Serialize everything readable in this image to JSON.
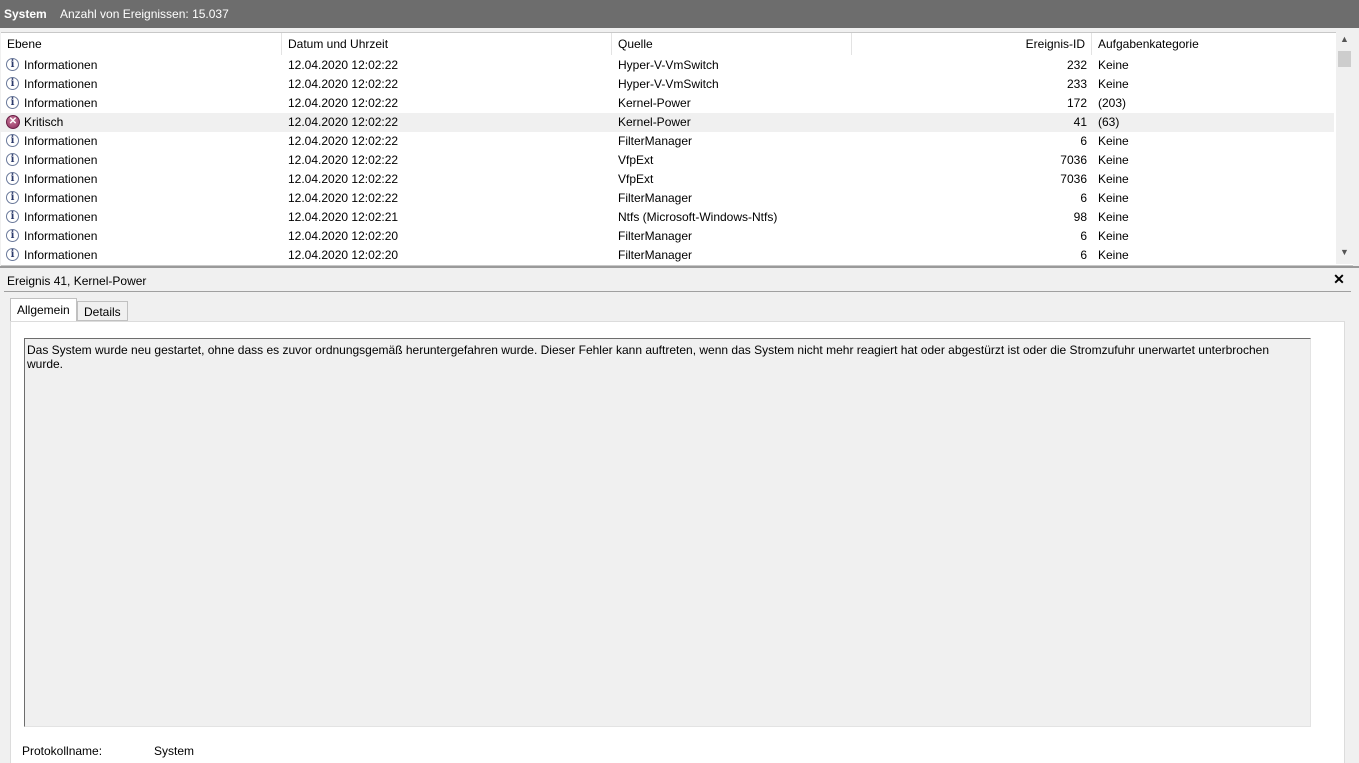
{
  "header": {
    "log_name": "System",
    "event_count_text": "Anzahl von Ereignissen: 15.037"
  },
  "table": {
    "columns": [
      "Ebene",
      "Datum und Uhrzeit",
      "Quelle",
      "Ereignis-ID",
      "Aufgabenkategorie"
    ],
    "rows": [
      {
        "level": "Informationen",
        "level_icon": "info-icon",
        "datetime": "12.04.2020 12:02:22",
        "source": "Hyper-V-VmSwitch",
        "id": "232",
        "category": "Keine"
      },
      {
        "level": "Informationen",
        "level_icon": "info-icon",
        "datetime": "12.04.2020 12:02:22",
        "source": "Hyper-V-VmSwitch",
        "id": "233",
        "category": "Keine"
      },
      {
        "level": "Informationen",
        "level_icon": "info-icon",
        "datetime": "12.04.2020 12:02:22",
        "source": "Kernel-Power",
        "id": "172",
        "category": "(203)"
      },
      {
        "level": "Kritisch",
        "level_icon": "critical-icon",
        "datetime": "12.04.2020 12:02:22",
        "source": "Kernel-Power",
        "id": "41",
        "category": "(63)",
        "selected": true
      },
      {
        "level": "Informationen",
        "level_icon": "info-icon",
        "datetime": "12.04.2020 12:02:22",
        "source": "FilterManager",
        "id": "6",
        "category": "Keine"
      },
      {
        "level": "Informationen",
        "level_icon": "info-icon",
        "datetime": "12.04.2020 12:02:22",
        "source": "VfpExt",
        "id": "7036",
        "category": "Keine"
      },
      {
        "level": "Informationen",
        "level_icon": "info-icon",
        "datetime": "12.04.2020 12:02:22",
        "source": "VfpExt",
        "id": "7036",
        "category": "Keine"
      },
      {
        "level": "Informationen",
        "level_icon": "info-icon",
        "datetime": "12.04.2020 12:02:22",
        "source": "FilterManager",
        "id": "6",
        "category": "Keine"
      },
      {
        "level": "Informationen",
        "level_icon": "info-icon",
        "datetime": "12.04.2020 12:02:21",
        "source": "Ntfs (Microsoft-Windows-Ntfs)",
        "id": "98",
        "category": "Keine"
      },
      {
        "level": "Informationen",
        "level_icon": "info-icon",
        "datetime": "12.04.2020 12:02:20",
        "source": "FilterManager",
        "id": "6",
        "category": "Keine"
      },
      {
        "level": "Informationen",
        "level_icon": "info-icon",
        "datetime": "12.04.2020 12:02:20",
        "source": "FilterManager",
        "id": "6",
        "category": "Keine"
      }
    ]
  },
  "detail": {
    "title": "Ereignis 41, Kernel-Power",
    "tabs": [
      "Allgemein",
      "Details"
    ],
    "description": "Das System wurde neu gestartet, ohne dass es zuvor ordnungsgemäß heruntergefahren wurde. Dieser Fehler kann auftreten, wenn das System nicht mehr reagiert hat oder abgestürzt ist oder die Stromzufuhr unerwartet unterbrochen wurde.",
    "log_name_label": "Protokollname:",
    "log_name_value": "System"
  },
  "icons": {
    "close": "close-icon",
    "scroll_up": "chevron-up-icon",
    "scroll_down": "chevron-down-icon"
  }
}
